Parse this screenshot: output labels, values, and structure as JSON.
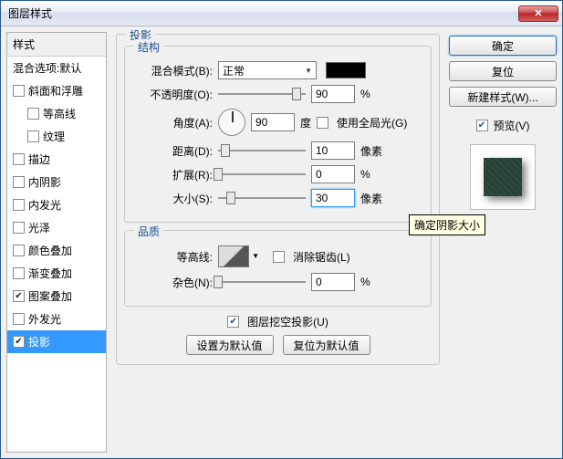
{
  "title": "图层样式",
  "sidebar": {
    "header": "样式",
    "blend_default": "混合选项:默认",
    "items": [
      {
        "label": "斜面和浮雕",
        "checked": false,
        "indent": false
      },
      {
        "label": "等高线",
        "checked": false,
        "indent": true
      },
      {
        "label": "纹理",
        "checked": false,
        "indent": true
      },
      {
        "label": "描边",
        "checked": false,
        "indent": false
      },
      {
        "label": "内阴影",
        "checked": false,
        "indent": false
      },
      {
        "label": "内发光",
        "checked": false,
        "indent": false
      },
      {
        "label": "光泽",
        "checked": false,
        "indent": false
      },
      {
        "label": "颜色叠加",
        "checked": false,
        "indent": false
      },
      {
        "label": "渐变叠加",
        "checked": false,
        "indent": false
      },
      {
        "label": "图案叠加",
        "checked": true,
        "indent": false
      },
      {
        "label": "外发光",
        "checked": false,
        "indent": false
      },
      {
        "label": "投影",
        "checked": true,
        "indent": false,
        "selected": true
      }
    ]
  },
  "panel": {
    "title": "投影",
    "structure": {
      "legend": "结构",
      "blend_mode_label": "混合模式(B):",
      "blend_mode_value": "正常",
      "opacity_label": "不透明度(O):",
      "opacity_value": "90",
      "opacity_unit": "%",
      "angle_label": "角度(A):",
      "angle_value": "90",
      "angle_unit": "度",
      "global_light_label": "使用全局光(G)",
      "distance_label": "距离(D):",
      "distance_value": "10",
      "distance_unit": "像素",
      "spread_label": "扩展(R):",
      "spread_value": "0",
      "spread_unit": "%",
      "size_label": "大小(S):",
      "size_value": "30",
      "size_unit": "像素"
    },
    "quality": {
      "legend": "品质",
      "contour_label": "等高线:",
      "antialias_label": "消除锯齿(L)",
      "noise_label": "杂色(N):",
      "noise_value": "0",
      "noise_unit": "%"
    },
    "knockout_label": "图层挖空投影(U)",
    "set_default": "设置为默认值",
    "reset_default": "复位为默认值"
  },
  "right": {
    "ok": "确定",
    "cancel": "复位",
    "new_style": "新建样式(W)...",
    "preview": "预览(V)"
  },
  "tooltip": "确定阴影大小"
}
